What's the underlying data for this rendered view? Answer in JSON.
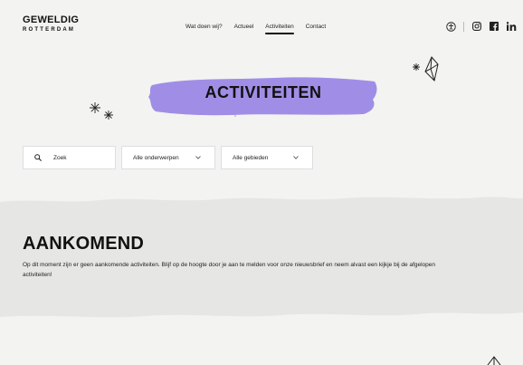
{
  "brand": {
    "line1": "GEWELDIG",
    "line2": "ROTTERDAM"
  },
  "nav": {
    "items": [
      {
        "label": "Wat doen wij?",
        "active": false
      },
      {
        "label": "Actueel",
        "active": false
      },
      {
        "label": "Activiteiten",
        "active": true
      },
      {
        "label": "Contact",
        "active": false
      }
    ]
  },
  "social": {
    "icons": [
      "accessibility-icon",
      "instagram-icon",
      "facebook-icon",
      "linkedin-icon"
    ]
  },
  "hero": {
    "title": "ACTIVITEITEN",
    "brush_color": "#a08ee6"
  },
  "filters": {
    "search_placeholder": "Zoek",
    "topic_selected": "Alle onderwerpen",
    "area_selected": "Alle gebieden"
  },
  "upcoming": {
    "title": "AANKOMEND",
    "text": "Op dit moment zijn er geen aankomende activiteiten. Blijf op de hoogte door je aan te melden voor onze nieuwsbrief en neem alvast een kijkje bij de afgelopen activiteiten!",
    "band_color": "#e6e6e4"
  },
  "colors": {
    "page_bg": "#f3f3f1",
    "text": "#111111"
  }
}
